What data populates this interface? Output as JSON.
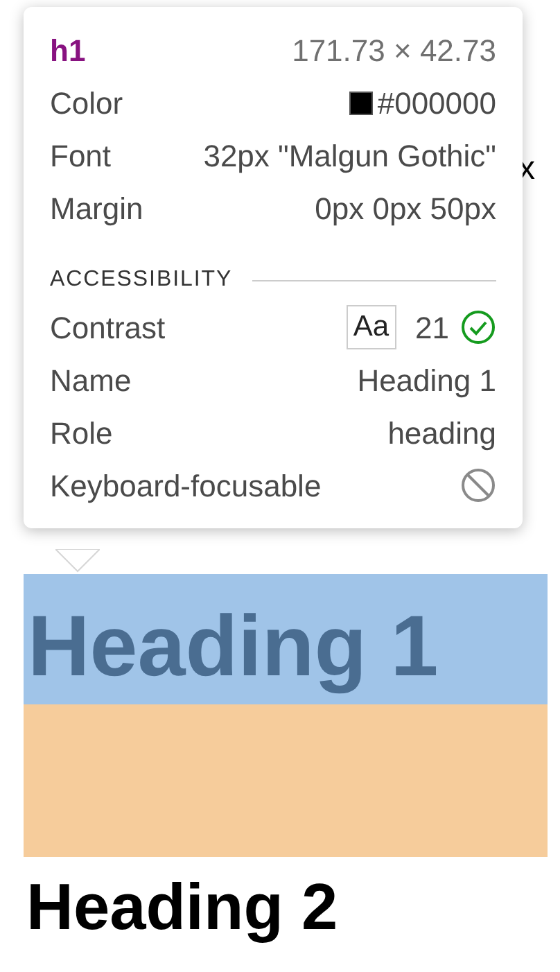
{
  "tooltip": {
    "tag": "h1",
    "size": "171.73 × 42.73",
    "rows": [
      {
        "kind": "swatch",
        "label": "Color",
        "value": "#000000"
      },
      {
        "kind": "text",
        "label": "Font",
        "value": "32px \"Malgun Gothic\""
      },
      {
        "kind": "text",
        "label": "Margin",
        "value": "0px 0px 50px"
      }
    ],
    "section": "ACCESSIBILITY",
    "a11y": [
      {
        "kind": "contrast",
        "label": "Contrast",
        "sample": "Aa",
        "value": "21",
        "passes": true
      },
      {
        "kind": "text",
        "label": "Name",
        "value": "Heading 1"
      },
      {
        "kind": "text",
        "label": "Role",
        "value": "heading"
      },
      {
        "kind": "flag",
        "label": "Keyboard-focusable",
        "on": false
      }
    ]
  },
  "background_text": "x",
  "highlighted_heading": "Heading 1",
  "heading_2": "Heading 2"
}
